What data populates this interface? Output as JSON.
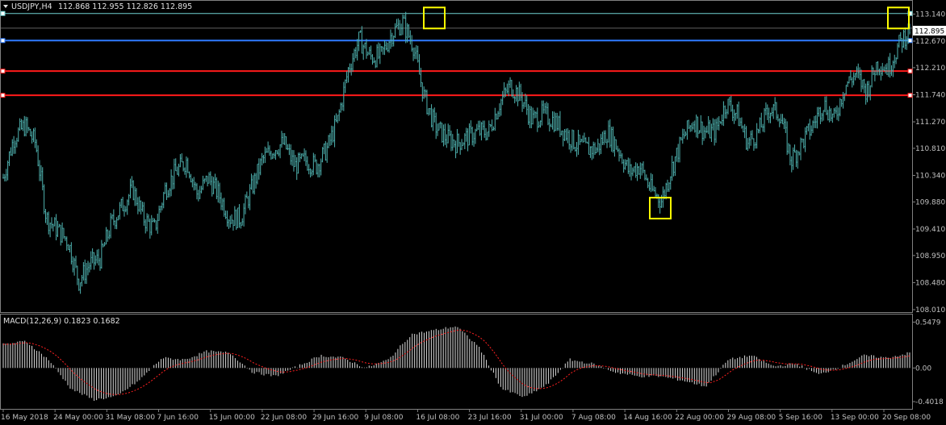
{
  "header": {
    "symbol_tf": "USDJPY,H4",
    "ohlc": "112.868 112.955 112.826 112.895"
  },
  "macd_header": "MACD(12,26,9) 0.1823 0.1682",
  "colors": {
    "background": "#000000",
    "candles": "#4fb3b0",
    "grid": "#3a3a3a",
    "red_level": "#ff1a1a",
    "blue_level": "#2f7bff",
    "cyan_level": "#6fd3d3",
    "highlight_box": "#ffff00",
    "macd_hist": "#c9c9c9",
    "macd_signal": "#ff2020",
    "current_price_label": "#ffffff"
  },
  "chart_data": [
    {
      "type": "candlestick",
      "title": "USDJPY,H4",
      "yticks": [
        "113.140",
        "112.670",
        "112.210",
        "111.740",
        "111.270",
        "110.810",
        "110.340",
        "109.880",
        "109.410",
        "108.950",
        "108.480",
        "108.010"
      ],
      "ylim": [
        108.01,
        113.3
      ],
      "current_price": "112.895",
      "xticks": [
        "16 May 2018",
        "24 May 00:00",
        "31 May 08:00",
        "7 Jun 16:00",
        "15 Jun 00:00",
        "22 Jun 08:00",
        "29 Jun 16:00",
        "9 Jul 08:00",
        "16 Jul 08:00",
        "23 Jul 16:00",
        "31 Jul 00:00",
        "7 Aug 08:00",
        "14 Aug 16:00",
        "22 Aug 00:00",
        "29 Aug 08:00",
        "5 Sep 16:00",
        "13 Sep 00:00",
        "20 Sep 08:00"
      ],
      "horizontal_levels": [
        {
          "price": 113.15,
          "color": "cyan"
        },
        {
          "price": 112.68,
          "color": "blue"
        },
        {
          "price": 112.15,
          "color": "red"
        },
        {
          "price": 111.73,
          "color": "red"
        }
      ],
      "highlighted_points": [
        {
          "label": "high",
          "date": "16 Jul 2018",
          "price": 113.1
        },
        {
          "label": "low",
          "date": "21 Aug 2018",
          "price": 109.8
        },
        {
          "label": "high",
          "date": "21 Sep 2018",
          "price": 113.1
        }
      ],
      "close_path": [
        {
          "date": "16 May",
          "close": 110.3
        },
        {
          "date": "18 May",
          "close": 111.0
        },
        {
          "date": "21 May",
          "close": 111.2
        },
        {
          "date": "22 May",
          "close": 110.9
        },
        {
          "date": "24 May",
          "close": 109.6
        },
        {
          "date": "25 May",
          "close": 109.4
        },
        {
          "date": "28 May",
          "close": 109.2
        },
        {
          "date": "29 May",
          "close": 108.5
        },
        {
          "date": "30 May",
          "close": 108.8
        },
        {
          "date": "31 May",
          "close": 108.9
        },
        {
          "date": "1 Jun",
          "close": 109.5
        },
        {
          "date": "4 Jun",
          "close": 109.8
        },
        {
          "date": "6 Jun",
          "close": 110.1
        },
        {
          "date": "7 Jun",
          "close": 109.6
        },
        {
          "date": "8 Jun",
          "close": 109.4
        },
        {
          "date": "11 Jun",
          "close": 110.1
        },
        {
          "date": "13 Jun",
          "close": 110.4
        },
        {
          "date": "15 Jun",
          "close": 110.6
        },
        {
          "date": "18 Jun",
          "close": 110.0
        },
        {
          "date": "20 Jun",
          "close": 110.3
        },
        {
          "date": "21 Jun",
          "close": 110.0
        },
        {
          "date": "22 Jun",
          "close": 109.6
        },
        {
          "date": "25 Jun",
          "close": 109.6
        },
        {
          "date": "26 Jun",
          "close": 110.1
        },
        {
          "date": "28 Jun",
          "close": 110.6
        },
        {
          "date": "29 Jun",
          "close": 110.8
        },
        {
          "date": "2 Jul",
          "close": 110.9
        },
        {
          "date": "3 Jul",
          "close": 110.5
        },
        {
          "date": "5 Jul",
          "close": 110.6
        },
        {
          "date": "6 Jul",
          "close": 110.5
        },
        {
          "date": "9 Jul",
          "close": 110.8
        },
        {
          "date": "10 Jul",
          "close": 111.3
        },
        {
          "date": "11 Jul",
          "close": 112.2
        },
        {
          "date": "12 Jul",
          "close": 112.7
        },
        {
          "date": "13 Jul",
          "close": 112.4
        },
        {
          "date": "16 Jul",
          "close": 112.4
        },
        {
          "date": "17 Jul",
          "close": 112.8
        },
        {
          "date": "18 Jul",
          "close": 113.0
        },
        {
          "date": "19 Jul",
          "close": 112.6
        },
        {
          "date": "20 Jul",
          "close": 111.7
        },
        {
          "date": "23 Jul",
          "close": 111.2
        },
        {
          "date": "24 Jul",
          "close": 111.0
        },
        {
          "date": "25 Jul",
          "close": 110.9
        },
        {
          "date": "26 Jul",
          "close": 111.0
        },
        {
          "date": "27 Jul",
          "close": 111.1
        },
        {
          "date": "30 Jul",
          "close": 111.1
        },
        {
          "date": "31 Jul",
          "close": 111.6
        },
        {
          "date": "1 Aug",
          "close": 111.9
        },
        {
          "date": "2 Aug",
          "close": 111.7
        },
        {
          "date": "3 Aug",
          "close": 111.3
        },
        {
          "date": "6 Aug",
          "close": 111.4
        },
        {
          "date": "7 Aug",
          "close": 111.3
        },
        {
          "date": "8 Aug",
          "close": 111.1
        },
        {
          "date": "9 Aug",
          "close": 110.9
        },
        {
          "date": "10 Aug",
          "close": 110.8
        },
        {
          "date": "13 Aug",
          "close": 110.8
        },
        {
          "date": "14 Aug",
          "close": 111.1
        },
        {
          "date": "15 Aug",
          "close": 110.8
        },
        {
          "date": "16 Aug",
          "close": 110.4
        },
        {
          "date": "17 Aug",
          "close": 110.5
        },
        {
          "date": "20 Aug",
          "close": 110.1
        },
        {
          "date": "21 Aug",
          "close": 109.9
        },
        {
          "date": "22 Aug",
          "close": 110.5
        },
        {
          "date": "23 Aug",
          "close": 111.0
        },
        {
          "date": "24 Aug",
          "close": 111.3
        },
        {
          "date": "27 Aug",
          "close": 111.1
        },
        {
          "date": "28 Aug",
          "close": 111.1
        },
        {
          "date": "29 Aug",
          "close": 111.6
        },
        {
          "date": "30 Aug",
          "close": 111.4
        },
        {
          "date": "31 Aug",
          "close": 110.9
        },
        {
          "date": "3 Sep",
          "close": 111.1
        },
        {
          "date": "4 Sep",
          "close": 111.5
        },
        {
          "date": "5 Sep",
          "close": 111.4
        },
        {
          "date": "6 Sep",
          "close": 110.6
        },
        {
          "date": "7 Sep",
          "close": 110.9
        },
        {
          "date": "10 Sep",
          "close": 111.2
        },
        {
          "date": "11 Sep",
          "close": 111.6
        },
        {
          "date": "12 Sep",
          "close": 111.3
        },
        {
          "date": "13 Sep",
          "close": 111.9
        },
        {
          "date": "14 Sep",
          "close": 112.1
        },
        {
          "date": "17 Sep",
          "close": 111.8
        },
        {
          "date": "18 Sep",
          "close": 112.3
        },
        {
          "date": "19 Sep",
          "close": 112.2
        },
        {
          "date": "20 Sep",
          "close": 112.6
        },
        {
          "date": "21 Sep",
          "close": 112.895
        }
      ]
    },
    {
      "type": "macd-histogram",
      "title": "MACD(12,26,9) 0.1823 0.1682",
      "yticks": [
        "0.5479",
        "0.00",
        "-0.4018"
      ],
      "ylim": [
        -0.45,
        0.6
      ],
      "macd_path": [
        {
          "date": "16 May",
          "value": 0.28
        },
        {
          "date": "20 May",
          "value": 0.32
        },
        {
          "date": "23 May",
          "value": 0.1
        },
        {
          "date": "25 May",
          "value": -0.25
        },
        {
          "date": "29 May",
          "value": -0.38
        },
        {
          "date": "31 May",
          "value": -0.34
        },
        {
          "date": "3 Jun",
          "value": -0.15
        },
        {
          "date": "6 Jun",
          "value": 0.12
        },
        {
          "date": "9 Jun",
          "value": 0.1
        },
        {
          "date": "12 Jun",
          "value": 0.2
        },
        {
          "date": "15 Jun",
          "value": 0.18
        },
        {
          "date": "19 Jun",
          "value": -0.05
        },
        {
          "date": "22 Jun",
          "value": -0.1
        },
        {
          "date": "26 Jun",
          "value": 0.02
        },
        {
          "date": "29 Jun",
          "value": 0.15
        },
        {
          "date": "3 Jul",
          "value": 0.12
        },
        {
          "date": "6 Jul",
          "value": 0.0
        },
        {
          "date": "9 Jul",
          "value": 0.1
        },
        {
          "date": "12 Jul",
          "value": 0.4
        },
        {
          "date": "16 Jul",
          "value": 0.45
        },
        {
          "date": "18 Jul",
          "value": 0.5
        },
        {
          "date": "20 Jul",
          "value": 0.25
        },
        {
          "date": "23 Jul",
          "value": -0.25
        },
        {
          "date": "26 Jul",
          "value": -0.35
        },
        {
          "date": "29 Jul",
          "value": -0.2
        },
        {
          "date": "1 Aug",
          "value": 0.1
        },
        {
          "date": "4 Aug",
          "value": 0.05
        },
        {
          "date": "7 Aug",
          "value": -0.05
        },
        {
          "date": "10 Aug",
          "value": -0.1
        },
        {
          "date": "14 Aug",
          "value": -0.1
        },
        {
          "date": "17 Aug",
          "value": -0.15
        },
        {
          "date": "21 Aug",
          "value": -0.22
        },
        {
          "date": "24 Aug",
          "value": 0.1
        },
        {
          "date": "28 Aug",
          "value": 0.15
        },
        {
          "date": "31 Aug",
          "value": 0.02
        },
        {
          "date": "4 Sep",
          "value": 0.05
        },
        {
          "date": "7 Sep",
          "value": -0.08
        },
        {
          "date": "11 Sep",
          "value": 0.02
        },
        {
          "date": "14 Sep",
          "value": 0.15
        },
        {
          "date": "18 Sep",
          "value": 0.12
        },
        {
          "date": "21 Sep",
          "value": 0.18
        }
      ]
    }
  ]
}
